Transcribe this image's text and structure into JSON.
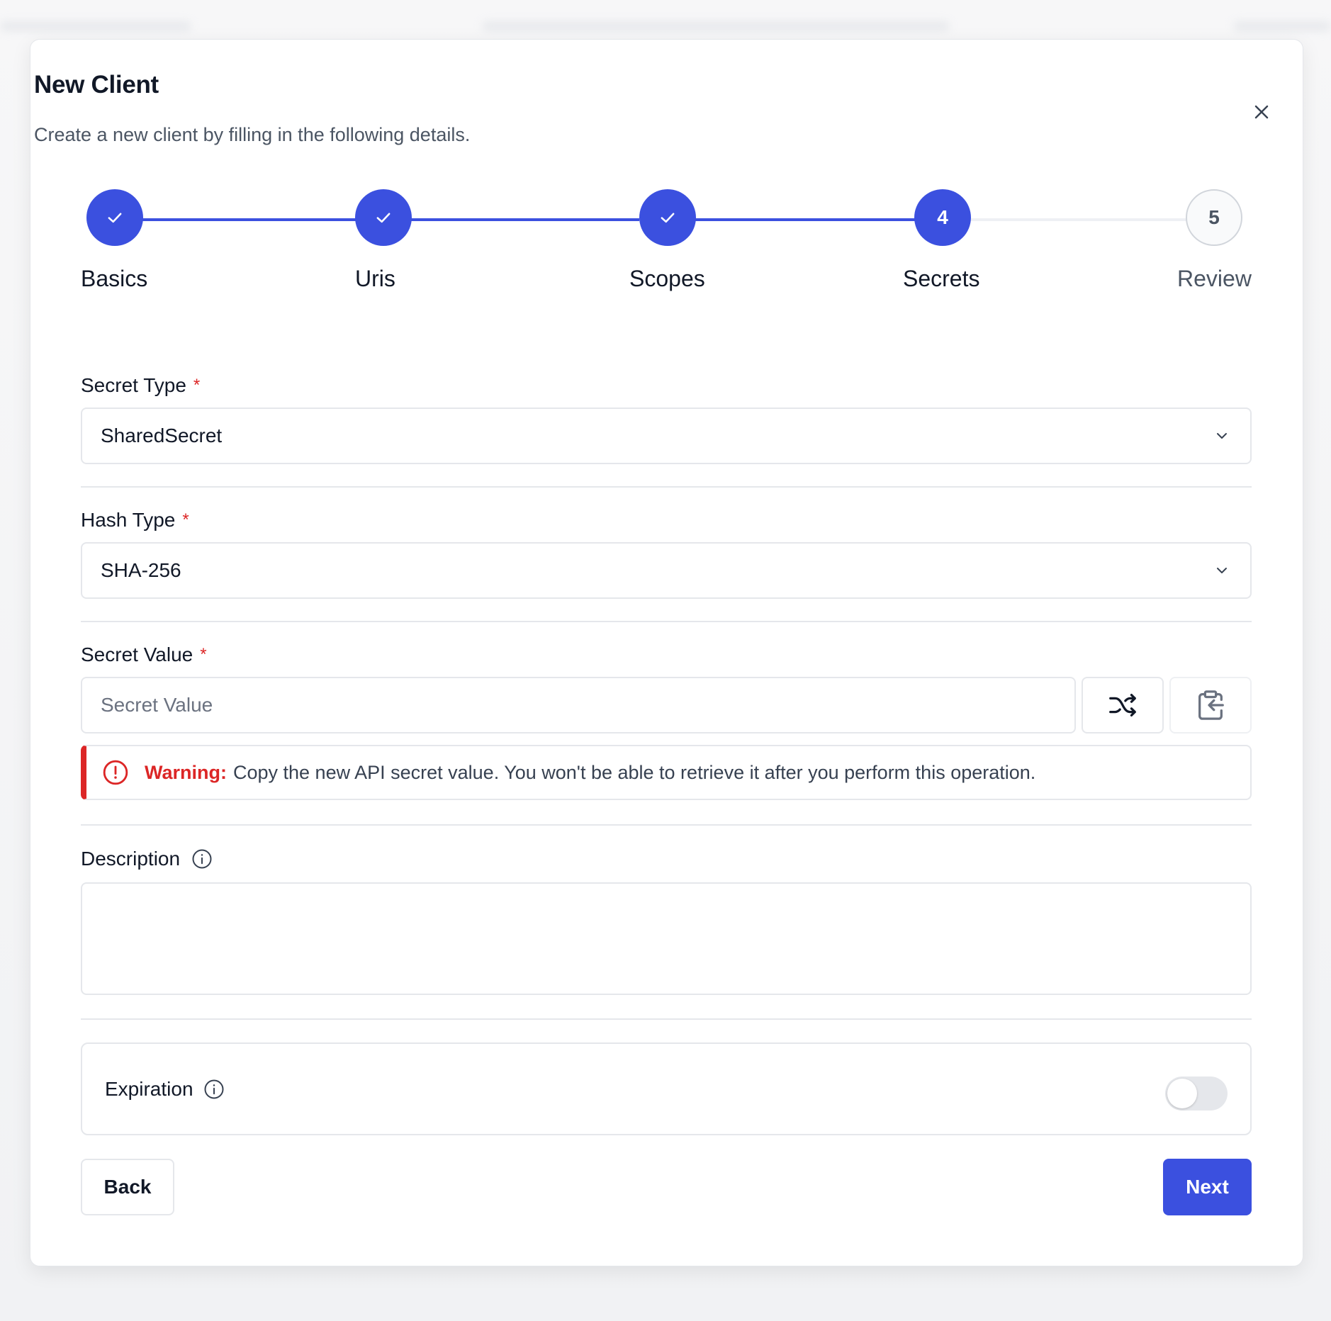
{
  "dialog": {
    "title": "New Client",
    "subtitle": "Create a new client by filling in the following details.",
    "close_icon": "close-icon"
  },
  "stepper": {
    "current_step": 4,
    "steps": [
      {
        "number": "1",
        "label": "Basics",
        "state": "completed"
      },
      {
        "number": "2",
        "label": "Uris",
        "state": "completed"
      },
      {
        "number": "3",
        "label": "Scopes",
        "state": "completed"
      },
      {
        "number": "4",
        "label": "Secrets",
        "state": "current"
      },
      {
        "number": "5",
        "label": "Review",
        "state": "pending"
      }
    ]
  },
  "form": {
    "secret_type": {
      "label": "Secret Type",
      "required_marker": "*",
      "value": "SharedSecret"
    },
    "hash_type": {
      "label": "Hash Type",
      "required_marker": "*",
      "value": "SHA-256"
    },
    "secret_value": {
      "label": "Secret Value",
      "required_marker": "*",
      "placeholder": "Secret Value",
      "value": ""
    },
    "warning": {
      "strong": "Warning:",
      "text": "Copy the new API secret value. You won't be able to retrieve it after you perform this operation."
    },
    "description": {
      "label": "Description",
      "value": ""
    },
    "expiration": {
      "label": "Expiration",
      "enabled": false
    }
  },
  "actions": {
    "back_label": "Back",
    "next_label": "Next"
  },
  "colors": {
    "primary": "#3b50df",
    "danger": "#dc2626",
    "border": "#e5e7eb"
  }
}
